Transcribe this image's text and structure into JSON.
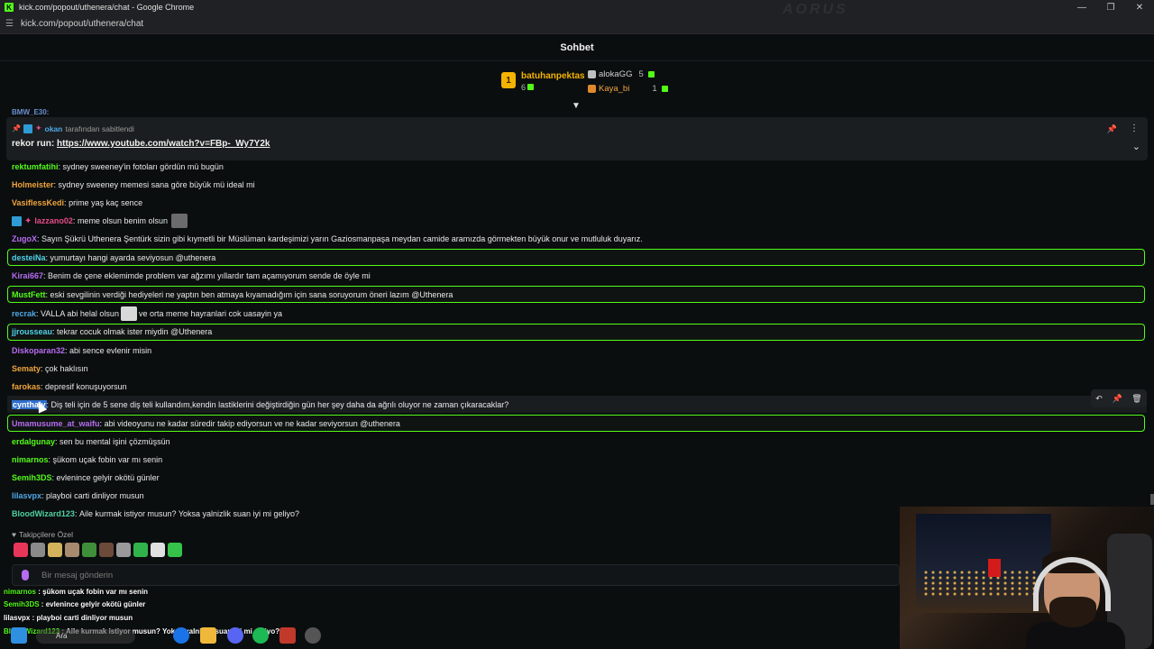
{
  "window": {
    "title": "kick.com/popout/uthenera/chat - Google Chrome",
    "url": "kick.com/popout/uthenera/chat",
    "watermark": "AORUS",
    "favicon_letter": "K"
  },
  "chat": {
    "header_title": "Sohbet",
    "peek_text": "BMW_E30:",
    "leaderboard": {
      "first": {
        "rank": "1",
        "name": "batuhanpektas",
        "count": "6"
      },
      "second": {
        "name": "alokaGG",
        "count": "5"
      },
      "third": {
        "name": "Kaya_bi",
        "count": "1"
      }
    },
    "pinned": {
      "by_user": "okan",
      "by_suffix": "tarafından sabitlendi",
      "user": "rekor run",
      "link": "https://www.youtube.com/watch?v=FBp-_Wy7Y2k"
    },
    "messages": [
      {
        "user": "rektumfatihi",
        "color": "#53fc18",
        "text": "sydney sweeney'in fotoları gördün mü bugün"
      },
      {
        "user": "Holmeister",
        "color": "#f0a43c",
        "text": "sydney sweeney memesi sana göre büyük mü ideal mi"
      },
      {
        "user": "VasiflessKedi",
        "color": "#f0a43c",
        "text": "prime yaş kaç sence"
      },
      {
        "user": "lazzano02",
        "color": "#e54b8a",
        "text": "meme olsun benim olsun"
      },
      {
        "user": "ZugoX",
        "color": "#b66cf0",
        "text": "Sayın Şükrü Uthenera Şentürk sizin gibi kıymetli bir Müslüman kardeşimizi yarın Gaziosmanpaşa meydan camide aramızda görmekten büyük onur ve mutluluk duyarız."
      },
      {
        "user": "desteiNa",
        "color": "#4fd1e8",
        "text": "yumurtayı hangi ayarda seviyosun @uthenera"
      },
      {
        "user": "Kirai667",
        "color": "#b66cf0",
        "text": "Benim de çene eklemimde problem var ağzımı yıllardır tam açamıyorum sende de öyle mi"
      },
      {
        "user": "MustFett",
        "color": "#53fc18",
        "text": "eski sevgilinin verdiği hediyeleri ne yaptın ben atmaya kıyamadığım için sana soruyorum öneri lazım @Uthenera"
      },
      {
        "user": "recrak",
        "color": "#4fa8e8",
        "text_before": "VALLA abi helal olsun",
        "text_after": "ve orta meme hayranlari cok uasayin ya"
      },
      {
        "user": "jjrousseau",
        "color": "#4fd1e8",
        "text": "tekrar cocuk olmak ister miydin @Uthenera"
      },
      {
        "user": "Diskoparan32",
        "color": "#b66cf0",
        "text": "abi sence evlenir misin"
      },
      {
        "user": "Sematy",
        "color": "#f0a43c",
        "text": "çok haklısın"
      },
      {
        "user": "farokas",
        "color": "#f0a43c",
        "text": "depresif konuşuyorsun"
      },
      {
        "user": "cynthalv",
        "color": "#4fa8e8",
        "text": "Diş teli için de 5 sene diş teli kullandım,kendin lastiklerini değiştirdiğin gün her şey daha da ağrılı oluyor ne zaman çıkaracaklar?"
      },
      {
        "user": "Umamusume_at_waifu",
        "color": "#b66cf0",
        "text": "abi videoyunu ne kadar süredir takip ediyorsun ve ne kadar seviyorsun @uthenera"
      },
      {
        "user": "erdalgunay",
        "color": "#53fc18",
        "text": "sen bu mental işini çözmüşsün"
      },
      {
        "user": "nimarnos",
        "color": "#53fc18",
        "text": "şükom uçak fobin var mı senin"
      },
      {
        "user": "Semih3DS",
        "color": "#53fc18",
        "text": "evlenince gelyir okötü günler"
      },
      {
        "user": "lilasvpx",
        "color": "#4fa8e8",
        "text": "playboi carti dinliyor musun"
      },
      {
        "user": "BloodWizard123",
        "color": "#4fd1a0",
        "text": "Aile kurmak istiyor musun? Yoksa yalnizlik suan iyi mi geliyo?"
      }
    ],
    "followers_only": "Takipçilere Özel",
    "input_placeholder": "Bir mesaj gönderin"
  },
  "overlay_chat": [
    {
      "user": "nimarnos",
      "text": "şükom uçak fobin var mı senin"
    },
    {
      "user": "Semih3DS",
      "text": "evlenince gelyir okötü günler"
    },
    {
      "user": "lilasvpx",
      "text": "playboi carti dinliyor musun"
    },
    {
      "user": "BloodWizard123",
      "text": "Aile kurmak istiyor musun? Yoksa yalnizlik suan iyi mi geliyo?"
    }
  ],
  "taskbar": {
    "search_label": "Ara"
  }
}
